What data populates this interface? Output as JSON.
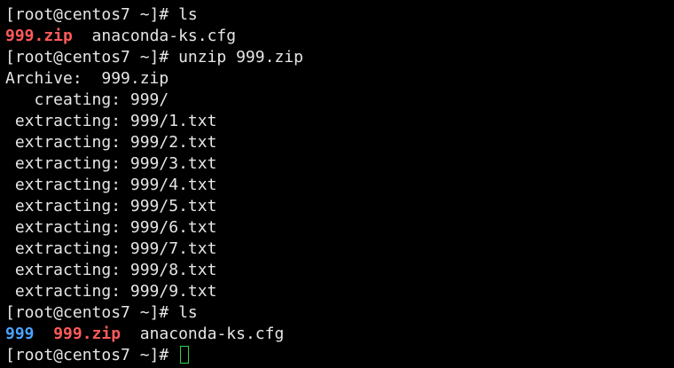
{
  "terminal": {
    "colors": {
      "background": "#000000",
      "foreground": "#e6e6e6",
      "archive": "#ff5a5a",
      "directory": "#4aa3ff",
      "cursor": "#34d14e"
    },
    "lines": {
      "l1": {
        "prompt": "[root@centos7 ~]# ",
        "command": "ls"
      },
      "l2": {
        "item1": "999.zip",
        "sep": "  ",
        "item2": "anaconda-ks.cfg"
      },
      "l3": {
        "prompt": "[root@centos7 ~]# ",
        "command": "unzip 999.zip"
      },
      "l4": "Archive:  999.zip",
      "l5": "   creating: 999/",
      "l6": " extracting: 999/1.txt",
      "l7": " extracting: 999/2.txt",
      "l8": " extracting: 999/3.txt",
      "l9": " extracting: 999/4.txt",
      "l10": " extracting: 999/5.txt",
      "l11": " extracting: 999/6.txt",
      "l12": " extracting: 999/7.txt",
      "l13": " extracting: 999/8.txt",
      "l14": " extracting: 999/9.txt",
      "l15": {
        "prompt": "[root@centos7 ~]# ",
        "command": "ls"
      },
      "l16": {
        "item1": "999",
        "sep1": "  ",
        "item2": "999.zip",
        "sep2": "  ",
        "item3": "anaconda-ks.cfg"
      },
      "l17": {
        "prompt": "[root@centos7 ~]# "
      }
    }
  }
}
